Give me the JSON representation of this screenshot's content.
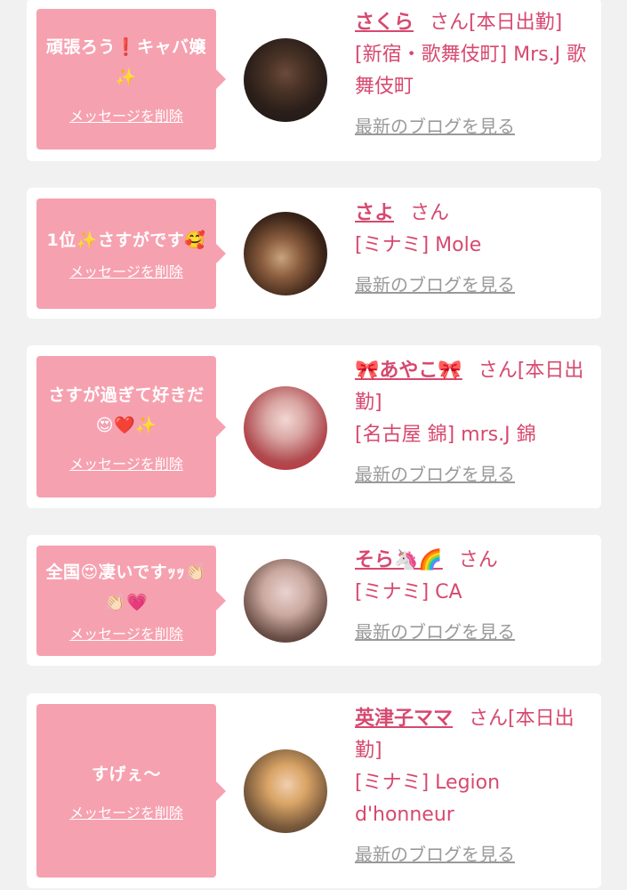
{
  "cards": [
    {
      "message": "頑張ろう❗キャバ嬢✨",
      "delete_label": "メッセージを削除",
      "name": "さくら",
      "suffix": "さん[本日出勤]",
      "shop": "[新宿・歌舞伎町] Mrs.J 歌舞伎町",
      "blog_label": "最新のブログを見る"
    },
    {
      "message": "1位✨さすがです🥰",
      "delete_label": "メッセージを削除",
      "name": "さよ",
      "suffix": "さん",
      "shop": "[ミナミ] Mole",
      "blog_label": "最新のブログを見る"
    },
    {
      "message": "さすが過ぎて好きだ😍❤️✨",
      "delete_label": "メッセージを削除",
      "name": "🎀あやこ🎀",
      "suffix": "さん[本日出勤]",
      "shop": "[名古屋 錦] mrs.J 錦",
      "blog_label": "最新のブログを見る"
    },
    {
      "message": "全国😍凄いですｯｯ👏🏻👏🏻💗",
      "delete_label": "メッセージを削除",
      "name": "そら🦄🌈",
      "suffix": "さん",
      "shop": "[ミナミ] CA",
      "blog_label": "最新のブログを見る"
    },
    {
      "message": "すげぇ〜",
      "delete_label": "メッセージを削除",
      "name": "英津子ママ",
      "suffix": "さん[本日出勤]",
      "shop": "[ミナミ] Legion d'honneur",
      "blog_label": "最新のブログを見る"
    }
  ]
}
